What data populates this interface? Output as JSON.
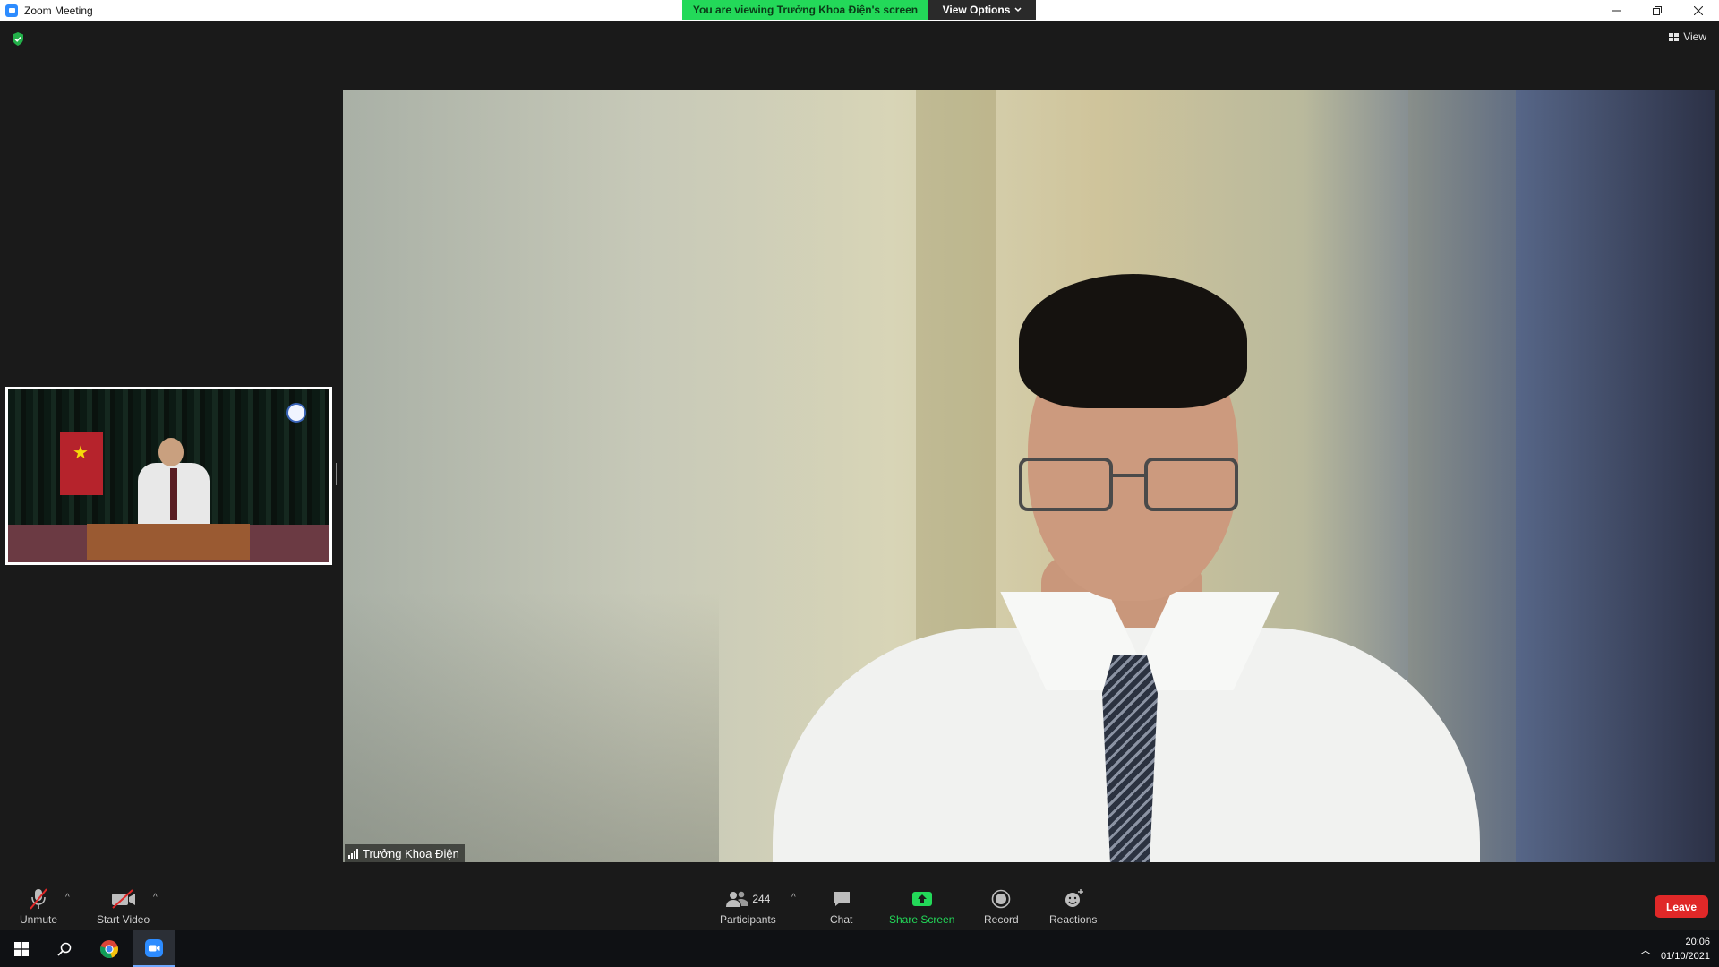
{
  "window": {
    "title": "Zoom Meeting"
  },
  "banner": {
    "viewing_text": "You are viewing Trưởng Khoa Điện's screen",
    "view_options_label": "View Options"
  },
  "top_right": {
    "view_label": "View"
  },
  "main_video": {
    "participant_name": "Trưởng Khoa Điện"
  },
  "toolbar": {
    "unmute_label": "Unmute",
    "start_video_label": "Start Video",
    "participants_label": "Participants",
    "participants_count": "244",
    "chat_label": "Chat",
    "share_screen_label": "Share Screen",
    "record_label": "Record",
    "reactions_label": "Reactions",
    "leave_label": "Leave"
  },
  "taskbar": {
    "time": "20:06",
    "date": "01/10/2021"
  },
  "colors": {
    "share_green": "#23d959",
    "leave_red": "#e02828",
    "zoom_blue": "#2d8cff"
  },
  "icons": [
    "zoom-logo-icon",
    "minimize-icon",
    "restore-icon",
    "close-icon",
    "chevron-down-icon",
    "shield-icon",
    "grid-view-icon",
    "signal-bars-icon",
    "mic-muted-icon",
    "video-off-icon",
    "participants-icon",
    "chat-bubble-icon",
    "share-arrow-icon",
    "record-icon",
    "reactions-icon",
    "windows-start-icon",
    "search-icon",
    "chrome-icon",
    "zoom-app-icon",
    "tray-chevron-icon"
  ]
}
